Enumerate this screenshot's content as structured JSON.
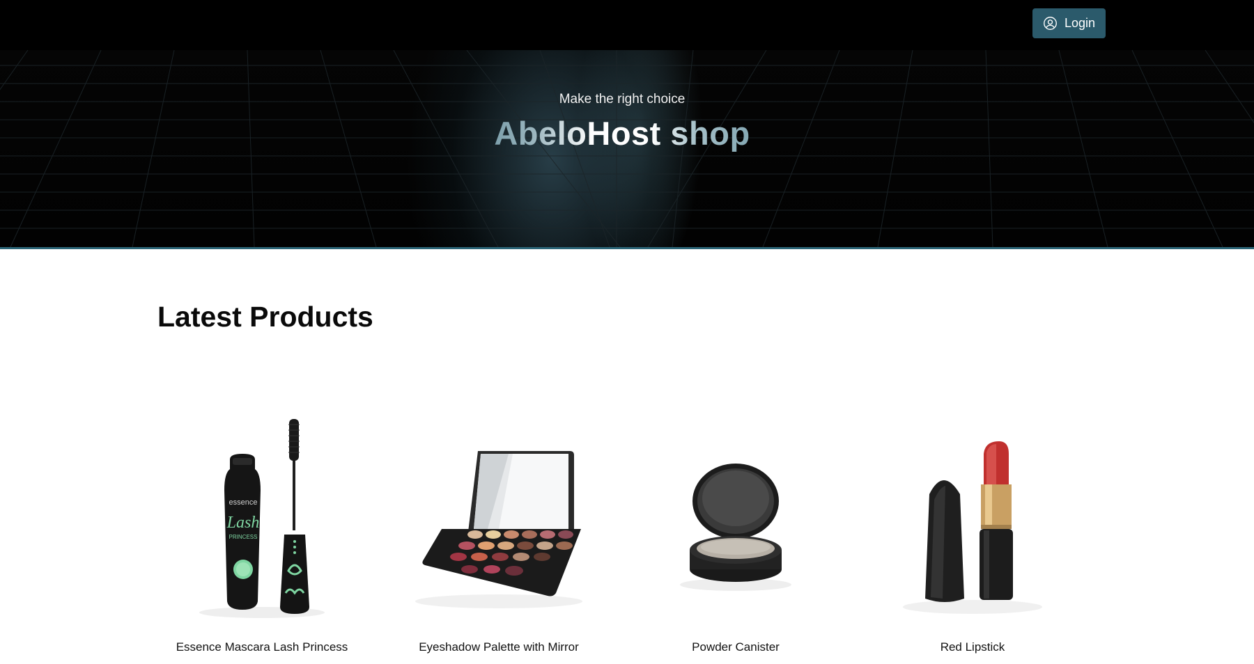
{
  "header": {
    "login_label": "Login",
    "login_icon": "user-circle-icon"
  },
  "hero": {
    "subtitle": "Make the right choice",
    "title": "AbeloHost shop"
  },
  "products_section": {
    "title": "Latest Products",
    "items": [
      {
        "name": "Essence Mascara Lash Princess",
        "icon": "mascara-image"
      },
      {
        "name": "Eyeshadow Palette with Mirror",
        "icon": "eyeshadow-palette-image"
      },
      {
        "name": "Powder Canister",
        "icon": "powder-canister-image"
      },
      {
        "name": "Red Lipstick",
        "icon": "lipstick-image"
      }
    ]
  },
  "colors": {
    "nav_bg": "#000000",
    "login_bg": "#2b5a6b",
    "hero_accent": "#2c6678",
    "page_bg": "#ffffff"
  }
}
